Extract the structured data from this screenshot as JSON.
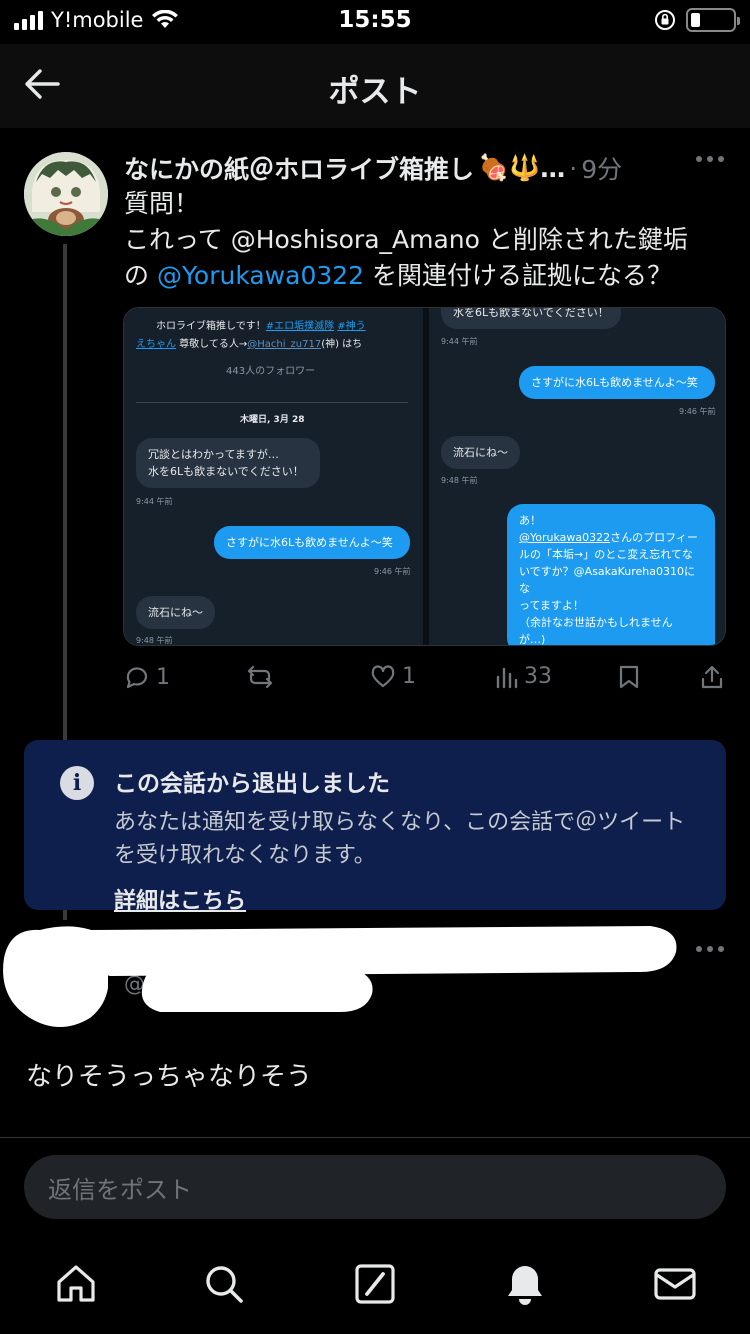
{
  "status_bar": {
    "carrier": "Y!mobile",
    "time": "15:55"
  },
  "header": {
    "title": "ポスト"
  },
  "tweet": {
    "author_name": "なにかの紙＠ホロライブ箱推し",
    "author_emoji": "🍖🔱",
    "author_ellipsis": "…",
    "separator": "·",
    "time_ago": "9分",
    "text_line1": "質問！",
    "text_line2": "これって @Hoshisora_Amano と削除された鍵垢",
    "text_line3_prefix": "の ",
    "text_line3_mention": "@Yorukawa0322",
    "text_line3_suffix": " を関連付ける証拠になる？",
    "media": {
      "left": {
        "bio_line1": "ホロライブ箱推しです！",
        "bio_tag1": "#エロ垢撲滅隊",
        "bio_tag2": "#神う",
        "bio_line2_link": "えちゃん",
        "bio_line2_text": " 尊敬してる人→",
        "bio_line2_handle": "@Hachi_zu717",
        "bio_line2_end": "(神) はち",
        "followers": "443人のフォロワー",
        "date": "木曜日, 3月 28",
        "msg1_line1": "冗談とはわかってますが…",
        "msg1_line2": "水を6Lも飲まないでください！",
        "msg1_time": "9:44 午前",
        "msg2": "さすがに水6Lも飲めませんよ～笑",
        "msg2_time": "9:46 午前",
        "msg3": "流石にね～",
        "msg3_time": "9:48 午前"
      },
      "right": {
        "msg0": "水を6Lも飲まないでください！",
        "msg0_time": "9:44 午前",
        "msg1": "さすがに水6Lも飲めませんよ～笑",
        "msg1_time": "9:46 午前",
        "msg2": "流石にね～",
        "msg2_time": "9:48 午前",
        "msg3_line1": "あ！",
        "msg3_handle": "@Yorukawa0322",
        "msg3_line2": "さんのプロフィー",
        "msg3_line3": "ルの「本垢→」のとこ変え忘れてな",
        "msg3_line4": "いですか？@AsakaKureha0310にな",
        "msg3_line5": "ってますよ！",
        "msg3_line6": "（余計なお世話かもしれません",
        "msg3_line7": "が…)"
      }
    },
    "actions": {
      "replies": "1",
      "retweets": "",
      "likes": "1",
      "views": "33"
    }
  },
  "notice": {
    "icon": "i",
    "title": "この会話から退出しました",
    "body": "あなたは通知を受け取らなくなり、この会話で＠ツイートを受け取れなくなります。",
    "link": "詳細はこちら"
  },
  "reply": {
    "handle_prefix": "@",
    "text": "なりそうっちゃなりそう"
  },
  "reply_input": {
    "placeholder": "返信をポスト"
  },
  "colors": {
    "accent": "#1d9bf0",
    "background": "#000000",
    "notice_bg": "#0f1f4d",
    "muted": "#71767b"
  }
}
